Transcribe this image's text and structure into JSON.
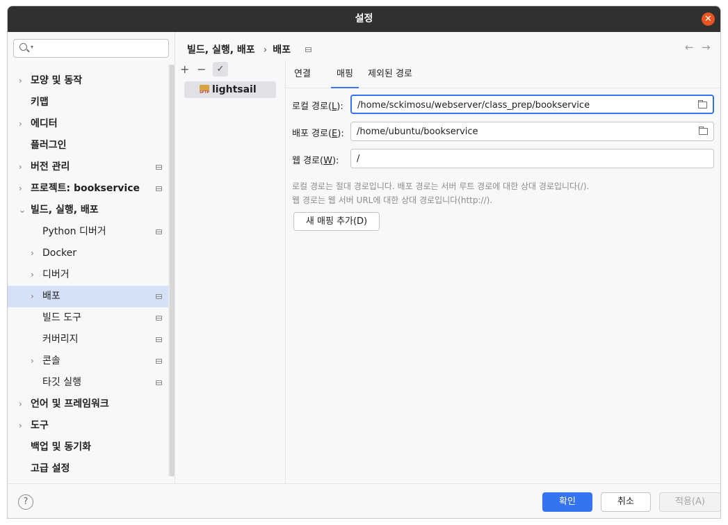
{
  "window": {
    "title": "설정"
  },
  "search": {
    "placeholder": ""
  },
  "sidebar": {
    "items": [
      {
        "label": "모양 및 동작"
      },
      {
        "label": "키맵"
      },
      {
        "label": "에디터"
      },
      {
        "label": "플러그인"
      },
      {
        "label": "버전 관리"
      },
      {
        "label": "프로젝트: bookservice"
      },
      {
        "label": "빌드, 실행, 배포"
      },
      {
        "label": "Python 디버거"
      },
      {
        "label": "Docker"
      },
      {
        "label": "디버거"
      },
      {
        "label": "배포"
      },
      {
        "label": "빌드 도구"
      },
      {
        "label": "커버리지"
      },
      {
        "label": "콘솔"
      },
      {
        "label": "타깃 실행"
      },
      {
        "label": "언어 및 프레임워크"
      },
      {
        "label": "도구"
      },
      {
        "label": "백업 및 동기화"
      },
      {
        "label": "고급 설정"
      }
    ]
  },
  "breadcrumb": {
    "parent": "빌드, 실행, 배포",
    "current": "배포"
  },
  "servers": {
    "toolbar": {
      "add": "+",
      "remove": "−",
      "check": "✓"
    },
    "items": [
      {
        "name": "lightsail",
        "icon_text": "SFTP"
      }
    ]
  },
  "tabs": [
    {
      "label": "연결"
    },
    {
      "label": "매핑"
    },
    {
      "label": "제외된 경로"
    }
  ],
  "mapping": {
    "local_label_pre": "로컬 경로(",
    "local_label_key": "L",
    "local_label_post": "):",
    "local_value": "/home/sckimosu/webserver/class_prep/bookservice",
    "deploy_label_pre": "배포 경로(",
    "deploy_label_key": "E",
    "deploy_label_post": "):",
    "deploy_value": "/home/ubuntu/bookservice",
    "web_label_pre": "웹 경로(",
    "web_label_key": "W",
    "web_label_post": "):",
    "web_value": "/",
    "hint1": "로컬 경로는 절대 경로입니다. 배포 경로는 서버 루트 경로에 대한 상대 경로입니다(/).",
    "hint2": "웹 경로는 웹 서버 URL에 대한 상대 경로입니다(http://).",
    "add_button": "새 매핑 추가(D)"
  },
  "footer": {
    "help": "?",
    "ok": "확인",
    "cancel": "취소",
    "apply": "적용(A)"
  },
  "colors": {
    "accent": "#3574f0",
    "selection": "#d5e1f7",
    "titlebar": "#303030",
    "close": "#e95420"
  }
}
